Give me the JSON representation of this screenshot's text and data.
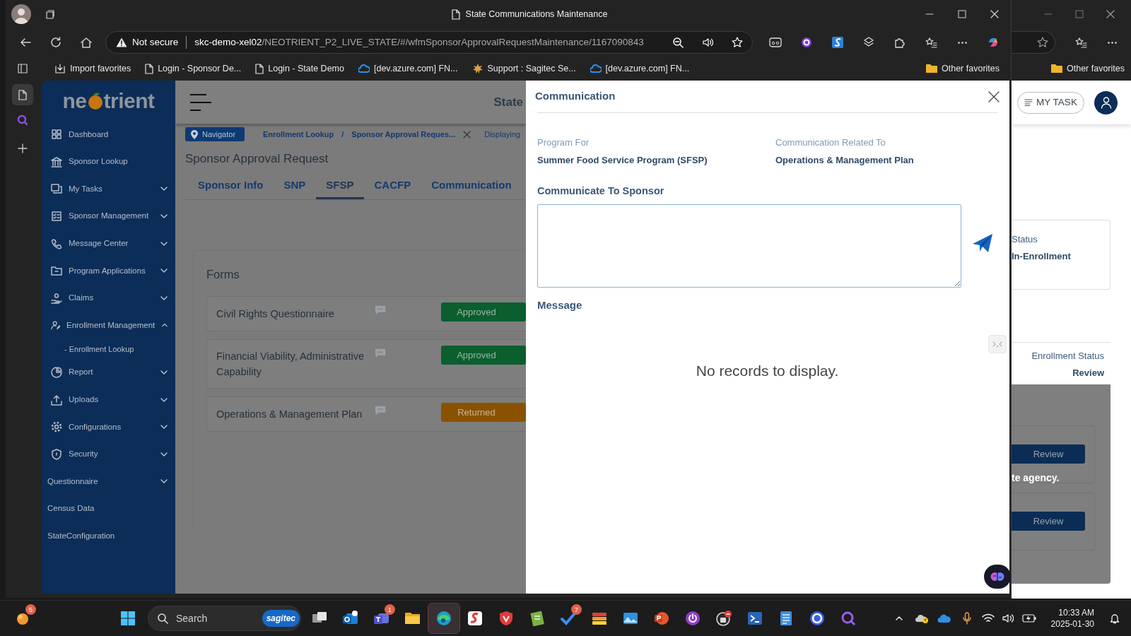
{
  "front_window": {
    "title": "State Communications Maintenance",
    "vertical_tabs": [
      {
        "selected": true
      },
      {
        "selected": false
      }
    ],
    "address": {
      "security": "Not secure",
      "host": "skc-demo-xel02",
      "path": "/NEOTRIENT_P2_LIVE_STATE/#/wfmSponsorApprovalRequestMaintenance/1167090843"
    },
    "favorites": [
      {
        "kind": "import",
        "label": "Import favorites"
      },
      {
        "kind": "page",
        "label": "Login - Sponsor De..."
      },
      {
        "kind": "page",
        "label": "Login - State Demo"
      },
      {
        "kind": "azure",
        "label": "[dev.azure.com] FN..."
      },
      {
        "kind": "support",
        "label": "Support : Sagitec Se..."
      },
      {
        "kind": "azure",
        "label": "[dev.azure.com] FN..."
      }
    ],
    "other_favorites": "Other favorites",
    "app": {
      "logo": {
        "left": "ne",
        "right": "trient"
      },
      "sidebar": [
        {
          "kind": "module",
          "label": "Dashboard"
        },
        {
          "kind": "module",
          "label": "Sponsor Lookup"
        },
        {
          "kind": "module",
          "label": "My Tasks",
          "expanded": false
        },
        {
          "kind": "module",
          "label": "Sponsor Management",
          "expanded": false
        },
        {
          "kind": "module",
          "label": "Message Center",
          "expanded": false
        },
        {
          "kind": "module",
          "label": "Program Applications",
          "expanded": false
        },
        {
          "kind": "module",
          "label": "Claims",
          "expanded": false
        },
        {
          "kind": "module",
          "label": "Enrollment Management",
          "expanded": true,
          "children": [
            {
              "bullet": "-",
              "label": "Enrollment Lookup"
            }
          ]
        },
        {
          "kind": "module",
          "label": "Report",
          "expanded": false
        },
        {
          "kind": "module",
          "label": "Uploads",
          "expanded": false
        },
        {
          "kind": "module",
          "label": "Configurations",
          "expanded": false
        },
        {
          "kind": "module",
          "label": "Security",
          "expanded": false
        },
        {
          "kind": "plain",
          "label": "Questionnaire",
          "expanded": false
        },
        {
          "kind": "plain",
          "label": "Census Data"
        },
        {
          "kind": "plain",
          "label": "StateConfiguration"
        }
      ],
      "header": {
        "title": "State"
      },
      "breadcrumb": {
        "navigator": "Navigator",
        "items": [
          "Enrollment Lookup",
          "Sponsor Approval Reques..."
        ],
        "separator": "/",
        "status": "Displaying"
      },
      "page": {
        "title": "Sponsor Approval Request",
        "tabs": [
          {
            "label": "Sponsor Info",
            "selected": false
          },
          {
            "label": "SNP",
            "selected": false
          },
          {
            "label": "SFSP",
            "selected": true
          },
          {
            "label": "CACFP",
            "selected": false
          },
          {
            "label": "Communication",
            "selected": false
          }
        ],
        "forms": {
          "title": "Forms",
          "rows": [
            {
              "name": "Civil Rights Questionnaire",
              "status": "Approved",
              "color": "#0b5e2e"
            },
            {
              "name": "Financial Viability, Administrative Capability",
              "status": "Approved",
              "color": "#0b5e2e"
            },
            {
              "name": "Operations & Management Plan",
              "status": "Returned",
              "color": "#8a5200"
            }
          ]
        }
      },
      "modal": {
        "title": "Communication",
        "fields": [
          {
            "label": "Program For",
            "value": "Summer Food Service Program (SFSP)"
          },
          {
            "label": "Communication Related To",
            "value": "Operations & Management Plan"
          }
        ],
        "compose_label": "Communicate To Sponsor",
        "message_label": "Message",
        "empty_text": "No records to display."
      }
    }
  },
  "back_window": {
    "other_favorites": "Other favorites",
    "app": {
      "my_task": "MY TASK",
      "status": {
        "label": "Status",
        "value": "In-Enrollment"
      },
      "enrollment_status": {
        "label": "Enrollment Status",
        "value": "Review"
      },
      "review_buttons": [
        "Review",
        "Review"
      ],
      "note": "te agency."
    }
  },
  "taskbar": {
    "widgets_badge": "5",
    "search": {
      "placeholder": "Search",
      "brand": "sagitec"
    },
    "apps": [
      {
        "active": false
      },
      {
        "active": false
      },
      {
        "active": false,
        "badge": "1"
      },
      {
        "active": false
      },
      {
        "active": true
      },
      {
        "active": false
      },
      {
        "active": false
      },
      {
        "active": false
      },
      {
        "active": false,
        "badge": "7"
      },
      {
        "active": false
      },
      {
        "active": false
      },
      {
        "active": false
      },
      {
        "active": false
      },
      {
        "active": false
      },
      {
        "active": false
      },
      {
        "active": false
      },
      {
        "active": false
      },
      {
        "active": false
      }
    ],
    "time": "10:33 AM",
    "date": "2025-01-30"
  }
}
